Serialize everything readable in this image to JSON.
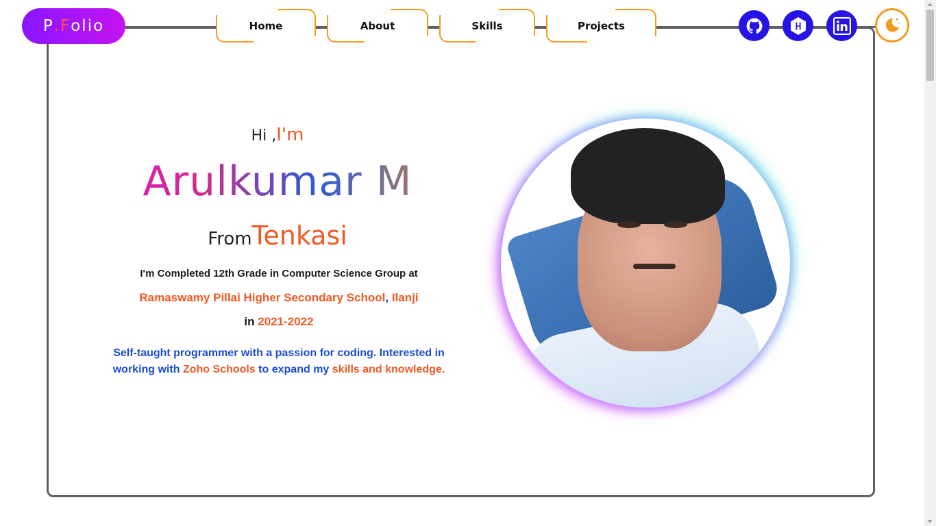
{
  "logo": {
    "p": "P",
    "dot": ".",
    "f": "F",
    "rest": "olio"
  },
  "nav": {
    "items": [
      "Home",
      "About",
      "Skills",
      "Projects"
    ]
  },
  "social": {
    "icons": [
      "github-icon",
      "hackerrank-icon",
      "linkedin-icon"
    ],
    "accent": "#2614e4"
  },
  "theme_toggle": {
    "icon": "moon-stars-icon",
    "accent": "#f39a1f"
  },
  "hero": {
    "greeting_hi": "Hi ,",
    "greeting_im": "I'm",
    "name": "Arulkumar M",
    "from": "From",
    "place": "Tenkasi",
    "edu_line1": "I'm Completed 12th Grade in Computer Science Group at",
    "school": "Ramaswamy Pillai Higher Secondary School",
    "comma": ",",
    "town": " Ilanji",
    "in": "in ",
    "years": "2021-2022",
    "bio_part1": "Self-taught programmer with a passion for coding. Interested in working with ",
    "bio_hl1": "Zoho Schools",
    "bio_part2": " to expand my ",
    "bio_hl2": "skills and knowledge."
  },
  "colors": {
    "accent_orange": "#ee5a24",
    "accent_blue": "#1a4bd2",
    "logo_purple": "#8a16ff"
  }
}
